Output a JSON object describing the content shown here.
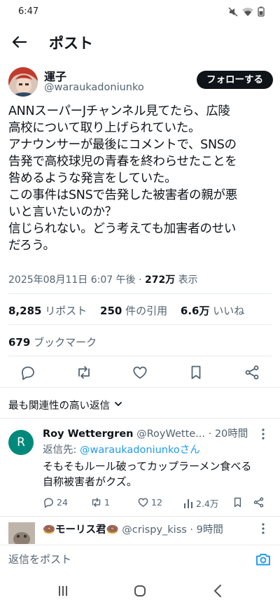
{
  "status_bar": {
    "time": "6:47",
    "icons": [
      "mute-icon",
      "wifi-icon",
      "battery-icon"
    ]
  },
  "header": {
    "title": "ポスト",
    "back_icon": "arrow-left-icon"
  },
  "post": {
    "author": {
      "name": "運子",
      "handle": "@waraukadoniunko"
    },
    "follow_label": "フォローする",
    "text": "ANNスーパーJチャンネル見てたら、広陵\n高校について取り上げられていた。\nアナウンサーが最後にコメントで、SNSの\n告発で高校球児の青春を終わらせたことを\n咎めるような発言をしていた。\nこの事件はSNSで告発した被害者の親が悪\nいと言いたいのか？\n信じられない。どう考えても加害者のせい\nだろう。",
    "timestamp": "2025年08月11日 6:07 午後",
    "views": "272万",
    "views_label": "表示",
    "reposts": "8,285",
    "reposts_label": "リポスト",
    "quotes": "250",
    "quotes_label": "件の引用",
    "likes": "6.6万",
    "likes_label": "いいね",
    "bookmarks": "679",
    "bookmarks_label": "ブックマーク"
  },
  "actions": [
    "reply-icon",
    "repost-icon",
    "like-icon",
    "bookmark-icon",
    "share-icon"
  ],
  "sort_label": "最も関連性の高い返信",
  "replies": [
    {
      "avatar_letter": "R",
      "name": "Roy Wettergren",
      "handle": "@RoyWette...",
      "dot": "·",
      "time": "20時間",
      "reply_to_prefix": "返信先: ",
      "reply_to": "@waraukadoniunkoさん",
      "text": "そもそもルール破ってカップラーメン食べる\n自称被害者がクズ。",
      "counts": {
        "replies": "24",
        "reposts": "1",
        "likes": "12",
        "views": "2.4万"
      }
    },
    {
      "name": "🍩モーリス君🍩",
      "handle": "@crispy_kiss",
      "dot": "·",
      "time": "9時間"
    }
  ],
  "composer": {
    "placeholder": "返信をポスト"
  },
  "colors": {
    "accent": "#1d9bf0",
    "text": "#0f1419",
    "secondary": "#536471"
  }
}
